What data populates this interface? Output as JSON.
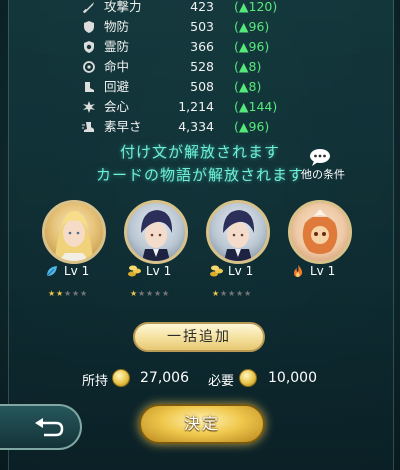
{
  "stats": [
    {
      "name": "攻撃力",
      "value": "423",
      "increase": "(▲120)",
      "icon": "sword-icon"
    },
    {
      "name": "物防",
      "value": "503",
      "increase": "(▲96)",
      "icon": "shield-icon"
    },
    {
      "name": "霊防",
      "value": "366",
      "increase": "(▲96)",
      "icon": "spirit-shield-icon"
    },
    {
      "name": "命中",
      "value": "528",
      "increase": "(▲8)",
      "icon": "target-icon"
    },
    {
      "name": "回避",
      "value": "508",
      "increase": "(▲8)",
      "icon": "boot-icon"
    },
    {
      "name": "会心",
      "value": "1,214",
      "increase": "(▲144)",
      "icon": "burst-icon"
    },
    {
      "name": "素早さ",
      "value": "4,334",
      "increase": "(▲96)",
      "icon": "speed-icon"
    }
  ],
  "messages": {
    "line1": "付け文が解放されます",
    "line2": "カードの物語が解放されます"
  },
  "other_conditions": {
    "label": "他の条件",
    "icon": "speech-bubble-icon"
  },
  "cards": [
    {
      "level": "Lv 1",
      "type_icon": "leaf-icon",
      "stars_filled": 2,
      "stars_total": 5,
      "portrait": "blonde-character-portrait"
    },
    {
      "level": "Lv 1",
      "type_icon": "coin-stack-icon",
      "stars_filled": 1,
      "stars_total": 5,
      "portrait": "dark-haired-character-portrait"
    },
    {
      "level": "Lv 1",
      "type_icon": "coin-stack-icon",
      "stars_filled": 1,
      "stars_total": 5,
      "portrait": "dark-haired-character-portrait"
    },
    {
      "level": "Lv 1",
      "type_icon": "flame-icon",
      "stars_filled": 0,
      "stars_total": 0,
      "portrait": "material-item-portrait"
    }
  ],
  "bulk_add": {
    "label": "一括追加"
  },
  "cost": {
    "owned_label": "所持",
    "owned_value": "27,006",
    "required_label": "必要",
    "required_value": "10,000",
    "icon": "gold-coin-icon"
  },
  "back_button": {
    "icon": "return-arrow-icon"
  },
  "decide_button": {
    "label": "決定"
  },
  "colors": {
    "increase": "#56e87a",
    "message": "#6ff0d8",
    "gold": "#e8c44a",
    "panel": "#143a3e"
  }
}
